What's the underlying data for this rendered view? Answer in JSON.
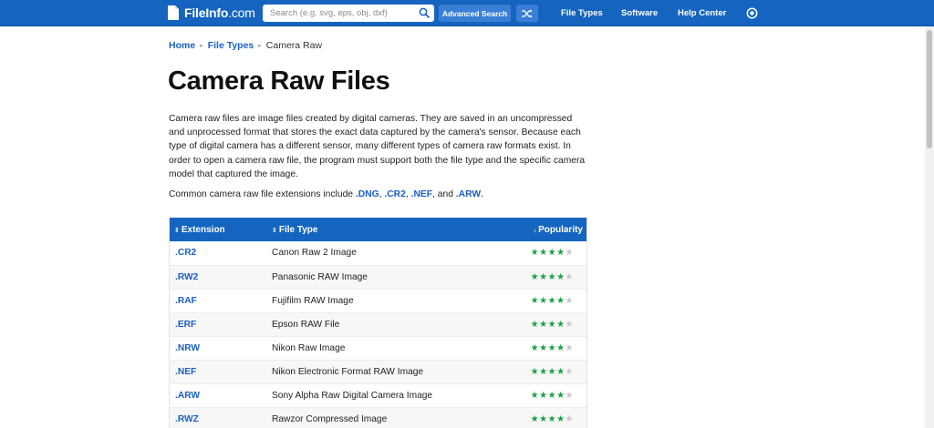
{
  "header": {
    "logo_text": "FileInfo",
    "logo_domain": ".com",
    "search_placeholder": "Search (e.g. svg, eps, obj, dxf)",
    "advanced_search_label": "Advanced Search",
    "nav": [
      "File Types",
      "Software",
      "Help Center"
    ],
    "brand_color": "#1565c0"
  },
  "breadcrumb": [
    "Home",
    "File Types",
    "Camera Raw"
  ],
  "title": "Camera Raw Files",
  "intro": "Camera raw files are image files created by digital cameras. They are saved in an uncompressed and unprocessed format that stores the exact data captured by the camera's sensor. Because each type of digital camera has a different sensor, many different types of camera raw formats exist. In order to open a camera raw file, the program must support both the file type and the specific camera model that captured the image.",
  "common": {
    "prefix": "Common camera raw file extensions include ",
    "exts": [
      ".DNG",
      ".CR2",
      ".NEF",
      ".ARW"
    ],
    "sep1": ", ",
    "sep2": ", ",
    "sep3": ", and ",
    "suffix": "."
  },
  "table": {
    "headers": [
      "Extension",
      "File Type",
      "Popularity"
    ],
    "sort_icons": [
      "⇕",
      "⇕",
      "↓"
    ],
    "rows": [
      {
        "ext": ".CR2",
        "type": "Canon Raw 2 Image",
        "stars": 4
      },
      {
        "ext": ".RW2",
        "type": "Panasonic RAW Image",
        "stars": 4
      },
      {
        "ext": ".RAF",
        "type": "Fujifilm RAW Image",
        "stars": 4
      },
      {
        "ext": ".ERF",
        "type": "Epson RAW File",
        "stars": 4
      },
      {
        "ext": ".NRW",
        "type": "Nikon Raw Image",
        "stars": 4
      },
      {
        "ext": ".NEF",
        "type": "Nikon Electronic Format RAW Image",
        "stars": 4
      },
      {
        "ext": ".ARW",
        "type": "Sony Alpha Raw Digital Camera Image",
        "stars": 4
      },
      {
        "ext": ".RWZ",
        "type": "Rawzor Compressed Image",
        "stars": 4
      }
    ],
    "max_stars": 5,
    "star_color": "#1e9e4a"
  }
}
